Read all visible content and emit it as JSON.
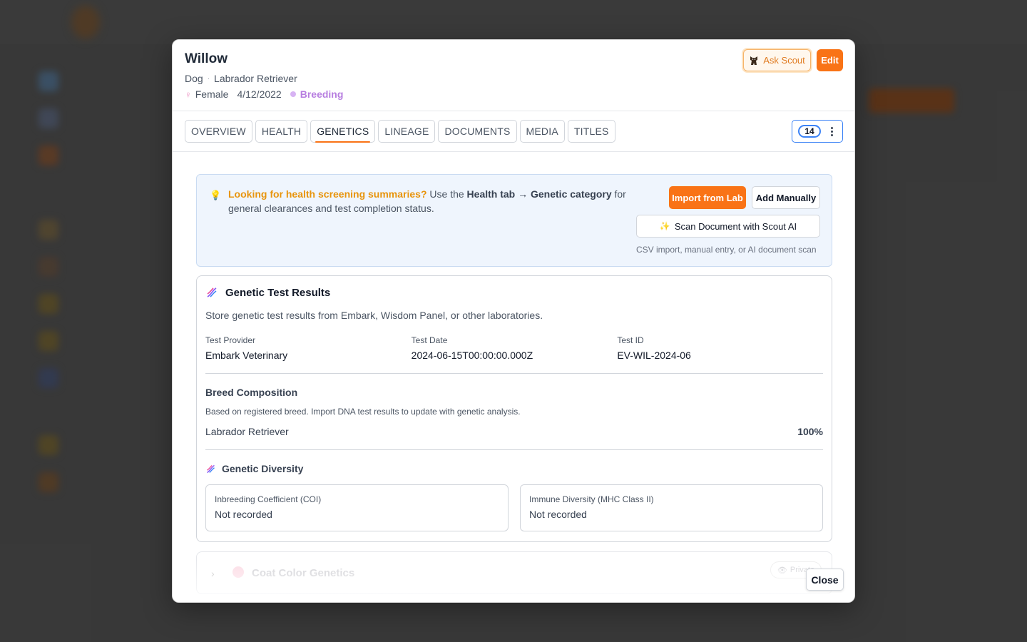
{
  "modal": {
    "title": "Willow",
    "species": "Dog",
    "breed": "Labrador Retriever",
    "sex": "Female",
    "birth_date": "4/12/2022",
    "status": "Breeding",
    "ask_button": "Ask Scout",
    "edit_button": "Edit",
    "close_button": "Close"
  },
  "tabs": [
    {
      "label": "OVERVIEW"
    },
    {
      "label": "HEALTH"
    },
    {
      "label": "GENETICS"
    },
    {
      "label": "LINEAGE"
    },
    {
      "label": "DOCUMENTS"
    },
    {
      "label": "MEDIA"
    },
    {
      "label": "TITLES"
    }
  ],
  "active_tab": "GENETICS",
  "counter": "14",
  "info": {
    "highlight": "Looking for health screening summaries?",
    "text_1": " Use the ",
    "bold_1": "Health tab → Genetic category",
    "text_2": " for general clearances and test completion status.",
    "import_button": "Import from Lab",
    "manual_button": "Add Manually",
    "scan_button": "Scan Document with Scout AI",
    "note": "CSV import, manual entry, or AI document scan"
  },
  "genetic_results": {
    "title": "Genetic Test Results",
    "description": "Store genetic test results from Embark, Wisdom Panel, or other laboratories.",
    "fields": [
      {
        "label": "Test Provider",
        "value": "Embark Veterinary"
      },
      {
        "label": "Test Date",
        "value": "2024-06-15T00:00:00.000Z"
      },
      {
        "label": "Test ID",
        "value": "EV-WIL-2024-06"
      }
    ],
    "breed_composition": {
      "title": "Breed Composition",
      "note": "Based on registered breed. Import DNA test results to update with genetic analysis.",
      "breed": "Labrador Retriever",
      "percent": "100%"
    },
    "genetic_diversity": {
      "title": "Genetic Diversity",
      "items": [
        {
          "label": "Inbreeding Coefficient (COI)",
          "value": "Not recorded"
        },
        {
          "label": "Immune Diversity (MHC Class II)",
          "value": "Not recorded"
        }
      ]
    }
  },
  "coat_color": {
    "title": "Coat Color Genetics",
    "privacy": "Private"
  },
  "colors": {
    "accent": "#f97316",
    "status_purple": "#b77ee0",
    "info_bg": "#eff5fd",
    "focus_blue": "#3b82f6"
  }
}
